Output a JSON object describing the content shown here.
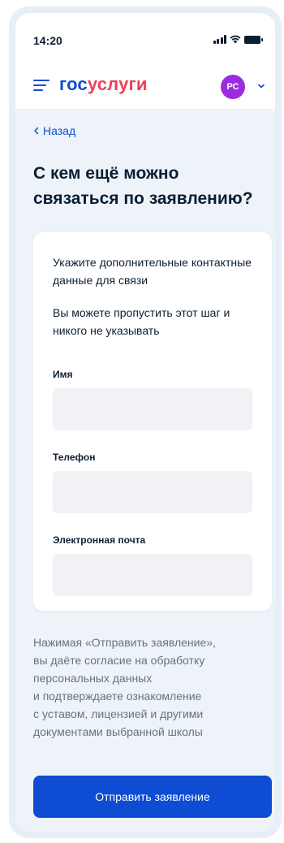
{
  "status_bar": {
    "time": "14:20"
  },
  "header": {
    "logo_part1": "гос",
    "logo_part2": "услуги",
    "avatar_initials": "РС"
  },
  "back_link": {
    "label": "Назад"
  },
  "page_title": "С кем ещё можно связаться по заявлению?",
  "card": {
    "intro_1": "Укажите дополнительные контактные данные для связи",
    "intro_2": "Вы можете пропустить этот шаг и никого не указывать",
    "fields": [
      {
        "label": "Имя",
        "value": ""
      },
      {
        "label": "Телефон",
        "value": ""
      },
      {
        "label": "Электронная почта",
        "value": ""
      }
    ]
  },
  "consent_text": "Нажимая «Отправить заявление»,\nвы даёте согласие на обработку\nперсональных данных\nи подтверждаете ознакомление\nс уставом, лицензией и другими\nдокументами выбранной школы",
  "submit_button": {
    "label": "Отправить заявление"
  },
  "colors": {
    "primary": "#0d4cd3",
    "brand_red": "#ee3f58",
    "avatar": "#9b2de0",
    "background": "#eef3f9",
    "input_bg": "#f1f2f5",
    "text": "#0b1f33",
    "muted_text": "#66727f"
  },
  "icons": [
    "menu-icon",
    "chevron-down-icon",
    "chevron-left-icon",
    "signal-icon",
    "wifi-icon",
    "battery-icon"
  ]
}
